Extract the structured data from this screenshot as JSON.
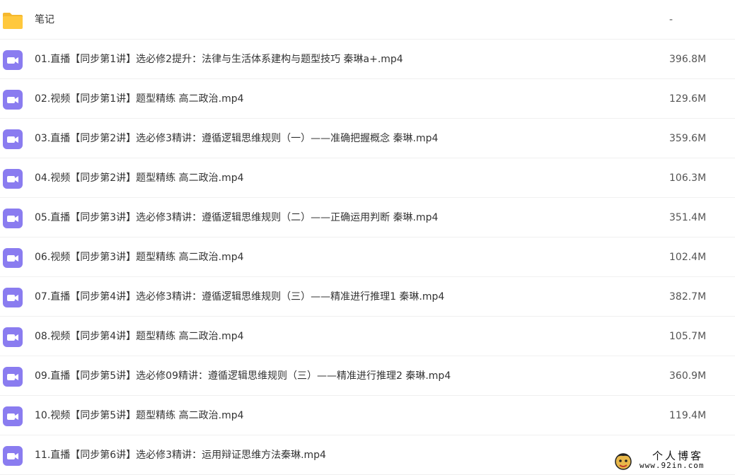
{
  "files": [
    {
      "type": "folder",
      "name": "笔记",
      "size": "-"
    },
    {
      "type": "video",
      "name": "01.直播【同步第1讲】选必修2提升：法律与生活体系建构与题型技巧 秦琳a+.mp4",
      "size": "396.8M"
    },
    {
      "type": "video",
      "name": "02.视频【同步第1讲】题型精练 高二政治.mp4",
      "size": "129.6M"
    },
    {
      "type": "video",
      "name": "03.直播【同步第2讲】选必修3精讲：遵循逻辑思维规则（一）——准确把握概念 秦琳.mp4",
      "size": "359.6M"
    },
    {
      "type": "video",
      "name": "04.视频【同步第2讲】题型精练 高二政治.mp4",
      "size": "106.3M"
    },
    {
      "type": "video",
      "name": "05.直播【同步第3讲】选必修3精讲：遵循逻辑思维规则（二）——正确运用判断 秦琳.mp4",
      "size": "351.4M"
    },
    {
      "type": "video",
      "name": "06.视频【同步第3讲】题型精练 高二政治.mp4",
      "size": "102.4M"
    },
    {
      "type": "video",
      "name": "07.直播【同步第4讲】选必修3精讲：遵循逻辑思维规则（三）——精准进行推理1 秦琳.mp4",
      "size": "382.7M"
    },
    {
      "type": "video",
      "name": "08.视频【同步第4讲】题型精练 高二政治.mp4",
      "size": "105.7M"
    },
    {
      "type": "video",
      "name": "09.直播【同步第5讲】选必修09精讲：遵循逻辑思维规则（三）——精准进行推理2 秦琳.mp4",
      "size": "360.9M"
    },
    {
      "type": "video",
      "name": "10.视频【同步第5讲】题型精练 高二政治.mp4",
      "size": "119.4M"
    },
    {
      "type": "video",
      "name": "11.直播【同步第6讲】选必修3精讲：运用辩证思维方法秦琳.mp4",
      "size": ""
    }
  ],
  "watermark": {
    "title": "个人博客",
    "url": "www.92in.com"
  },
  "colors": {
    "folder": "#ffc83d",
    "folder_tab": "#f5b82e",
    "video": "#8a7cf0",
    "text": "#333333",
    "size_text": "#555555",
    "divider": "#f0f0f0"
  }
}
